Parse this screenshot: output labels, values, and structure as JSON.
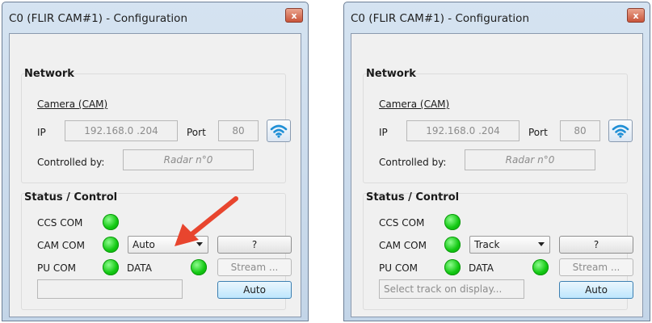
{
  "windows": [
    {
      "title": "C0 (FLIR CAM#1) - Configuration",
      "close_glyph": "x",
      "network": {
        "group_title": "Network",
        "camera_link": "Camera (CAM)",
        "ip_label": "IP",
        "ip_value": "192.168.0 .204",
        "port_label": "Port",
        "port_value": "80",
        "wifi_icon": "wifi-icon",
        "controlled_label": "Controlled by:",
        "controlled_value": "Radar n°0"
      },
      "status": {
        "group_title": "Status / Control",
        "ccs_label": "CCS COM",
        "cam_label": "CAM COM",
        "pu_label": "PU COM",
        "data_label": "DATA",
        "mode_value": "Auto",
        "help_button": "?",
        "stream_button": "Stream ...",
        "track_value": "",
        "auto_button": "Auto",
        "indicator_color": "#13c913"
      }
    },
    {
      "title": "C0 (FLIR CAM#1) - Configuration",
      "close_glyph": "x",
      "network": {
        "group_title": "Network",
        "camera_link": "Camera (CAM)",
        "ip_label": "IP",
        "ip_value": "192.168.0 .204",
        "port_label": "Port",
        "port_value": "80",
        "wifi_icon": "wifi-icon",
        "controlled_label": "Controlled by:",
        "controlled_value": "Radar n°0"
      },
      "status": {
        "group_title": "Status / Control",
        "ccs_label": "CCS COM",
        "cam_label": "CAM COM",
        "pu_label": "PU COM",
        "data_label": "DATA",
        "mode_value": "Track",
        "help_button": "?",
        "stream_button": "Stream ...",
        "track_value": "Select track on display...",
        "auto_button": "Auto",
        "indicator_color": "#13c913"
      }
    }
  ],
  "annotation": {
    "arrow_color": "#e8452e"
  }
}
